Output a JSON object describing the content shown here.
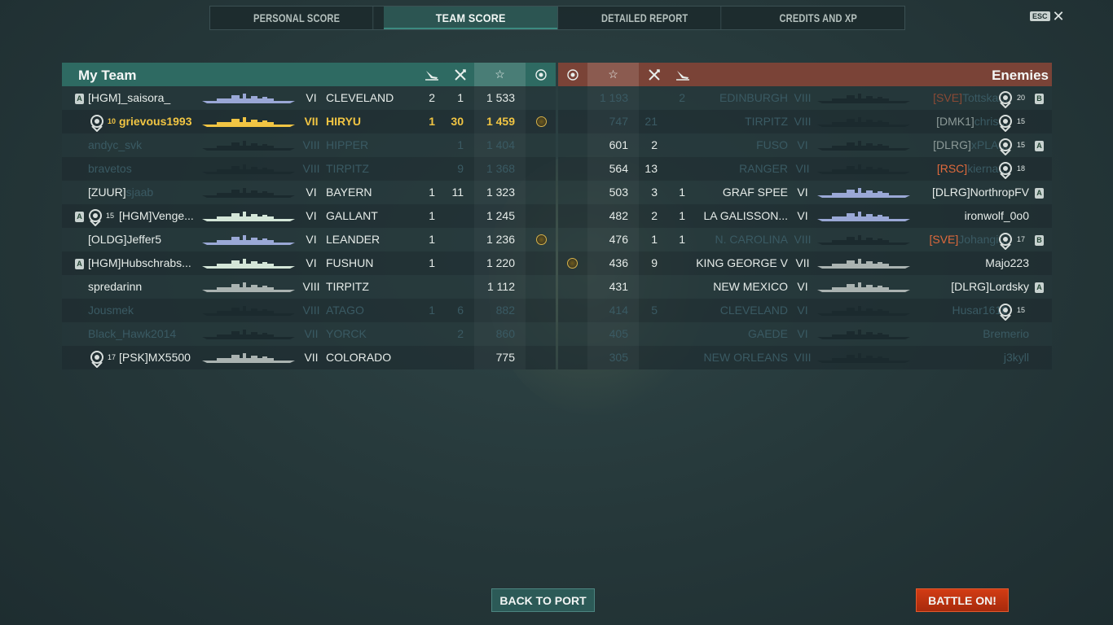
{
  "tabs": [
    {
      "label": "PERSONAL SCORE",
      "active": false
    },
    {
      "label": "TEAM SCORE",
      "active": true
    },
    {
      "label": "DETAILED REPORT",
      "active": false
    },
    {
      "label": "CREDITS AND XP",
      "active": false
    }
  ],
  "esc_label": "ESC",
  "my_team": {
    "title": "My Team",
    "rows": [
      {
        "name": "[HGM]_saisora_",
        "tier": "VI",
        "ship": "CLEVELAND",
        "c1": "2",
        "c2": "1",
        "score": "1 533",
        "medal": false,
        "status": "alive",
        "rank": "A",
        "level": ""
      },
      {
        "name": "grievous1993",
        "tier": "VII",
        "ship": "HIRYU",
        "c1": "1",
        "c2": "30",
        "score": "1 459",
        "medal": true,
        "status": "me",
        "rank": "",
        "level": "10"
      },
      {
        "name": "andyc_svk",
        "tier": "VIII",
        "ship": "HIPPER",
        "c1": "",
        "c2": "1",
        "score": "1 404",
        "medal": false,
        "status": "dead",
        "rank": "",
        "level": ""
      },
      {
        "name": "bravetos",
        "tier": "VIII",
        "ship": "TIRPITZ",
        "c1": "",
        "c2": "9",
        "score": "1 368",
        "medal": false,
        "status": "dead",
        "rank": "",
        "level": ""
      },
      {
        "name": "[ZUUR]sjaab",
        "clan": "[ZUUR]",
        "pname": "sjaab",
        "tier": "VI",
        "ship": "BAYERN",
        "c1": "1",
        "c2": "11",
        "score": "1 323",
        "medal": false,
        "status": "dead-partial",
        "rank": "",
        "level": ""
      },
      {
        "name": "[HGM]Venge...",
        "tier": "VI",
        "ship": "GALLANT",
        "c1": "1",
        "c2": "",
        "score": "1 245",
        "medal": false,
        "status": "alive",
        "rank": "A",
        "level": "15"
      },
      {
        "name": "[OLDG]Jeffer5",
        "tier": "VI",
        "ship": "LEANDER",
        "c1": "1",
        "c2": "",
        "score": "1 236",
        "medal": true,
        "status": "alive",
        "rank": "",
        "level": ""
      },
      {
        "name": "[HGM]Hubschrabs...",
        "tier": "VI",
        "ship": "FUSHUN",
        "c1": "1",
        "c2": "",
        "score": "1 220",
        "medal": false,
        "status": "alive",
        "rank": "A",
        "level": ""
      },
      {
        "name": "spredarinn",
        "tier": "VIII",
        "ship": "TIRPITZ",
        "c1": "",
        "c2": "",
        "score": "1 112",
        "medal": false,
        "status": "alive",
        "rank": "",
        "level": ""
      },
      {
        "name": "Jousmek",
        "tier": "VIII",
        "ship": "ATAGO",
        "c1": "1",
        "c2": "6",
        "score": "882",
        "medal": false,
        "status": "dead",
        "rank": "",
        "level": ""
      },
      {
        "name": "Black_Hawk2014",
        "tier": "VII",
        "ship": "YORCK",
        "c1": "",
        "c2": "2",
        "score": "860",
        "medal": false,
        "status": "dead",
        "rank": "",
        "level": ""
      },
      {
        "name": "[PSK]MX5500",
        "tier": "VII",
        "ship": "COLORADO",
        "c1": "",
        "c2": "",
        "score": "775",
        "medal": false,
        "status": "alive",
        "rank": "",
        "level": "17"
      }
    ]
  },
  "enemies": {
    "title": "Enemies",
    "rows": [
      {
        "score": "1 193",
        "c2": "",
        "c1": "2",
        "ship": "EDINBURGH",
        "tier": "VIII",
        "clan": "[SVE]",
        "pname": "Tottska...",
        "clan_red": true,
        "medal": false,
        "status": "dead",
        "rank": "B",
        "level": "20"
      },
      {
        "score": "747",
        "c2": "21",
        "c1": "",
        "ship": "TIRPITZ",
        "tier": "VIII",
        "clan": "[DMK1]",
        "pname": "chris...",
        "clan_red": false,
        "medal": false,
        "status": "dead",
        "rank": "",
        "level": "15"
      },
      {
        "score": "601",
        "c2": "2",
        "c1": "",
        "ship": "FUSO",
        "tier": "VI",
        "clan": "[DLRG]",
        "pname": "xPLA...",
        "clan_red": false,
        "medal": false,
        "status": "dead-partial",
        "rank": "A",
        "level": "15"
      },
      {
        "score": "564",
        "c2": "13",
        "c1": "",
        "ship": "RANGER",
        "tier": "VII",
        "clan": "[RSC]",
        "pname": "kierna...",
        "clan_red": true,
        "medal": false,
        "status": "dead-partial",
        "rank": "",
        "level": "18"
      },
      {
        "score": "503",
        "c2": "3",
        "c1": "1",
        "ship": "GRAF SPEE",
        "tier": "VI",
        "clan": "[DLRG]",
        "pname": "NorthropFV",
        "clan_red": false,
        "medal": false,
        "status": "alive",
        "rank": "A",
        "level": ""
      },
      {
        "score": "482",
        "c2": "2",
        "c1": "1",
        "ship": "LA GALISSON...",
        "tier": "VI",
        "clan": "",
        "pname": "ironwolf_0o0",
        "clan_red": false,
        "medal": false,
        "status": "alive",
        "rank": "",
        "level": ""
      },
      {
        "score": "476",
        "c2": "1",
        "c1": "1",
        "ship": "N. CAROLINA",
        "tier": "VIII",
        "clan": "[SVE]",
        "pname": "Johangi...",
        "clan_red": true,
        "medal": false,
        "status": "dead-partial",
        "rank": "B",
        "level": "17"
      },
      {
        "score": "436",
        "c2": "9",
        "c1": "",
        "ship": "KING GEORGE V",
        "tier": "VII",
        "clan": "",
        "pname": "Majo223",
        "clan_red": false,
        "medal": true,
        "status": "alive",
        "rank": "",
        "level": ""
      },
      {
        "score": "431",
        "c2": "",
        "c1": "",
        "ship": "NEW MEXICO",
        "tier": "VI",
        "clan": "[DLRG]",
        "pname": "Lordsky",
        "clan_red": false,
        "medal": false,
        "status": "alive",
        "rank": "A",
        "level": ""
      },
      {
        "score": "414",
        "c2": "5",
        "c1": "",
        "ship": "CLEVELAND",
        "tier": "VI",
        "clan": "",
        "pname": "Husar1610",
        "clan_red": false,
        "medal": false,
        "status": "dead",
        "rank": "",
        "level": "15"
      },
      {
        "score": "405",
        "c2": "",
        "c1": "",
        "ship": "GAEDE",
        "tier": "VI",
        "clan": "",
        "pname": "Bremerio",
        "clan_red": false,
        "medal": false,
        "status": "dead",
        "rank": "",
        "level": ""
      },
      {
        "score": "305",
        "c2": "",
        "c1": "",
        "ship": "NEW ORLEANS",
        "tier": "VIII",
        "clan": "",
        "pname": "j3kyll",
        "clan_red": false,
        "medal": false,
        "status": "dead",
        "rank": "",
        "level": ""
      }
    ]
  },
  "buttons": {
    "back": "BACK TO PORT",
    "battle": "BATTLE ON!"
  },
  "colors": {
    "team_header": "#2e6a62",
    "enemy_header": "#7a4337",
    "player_highlight": "#f1c543",
    "battle_button": "#c8360f",
    "clan_red": "#e06a3c"
  }
}
